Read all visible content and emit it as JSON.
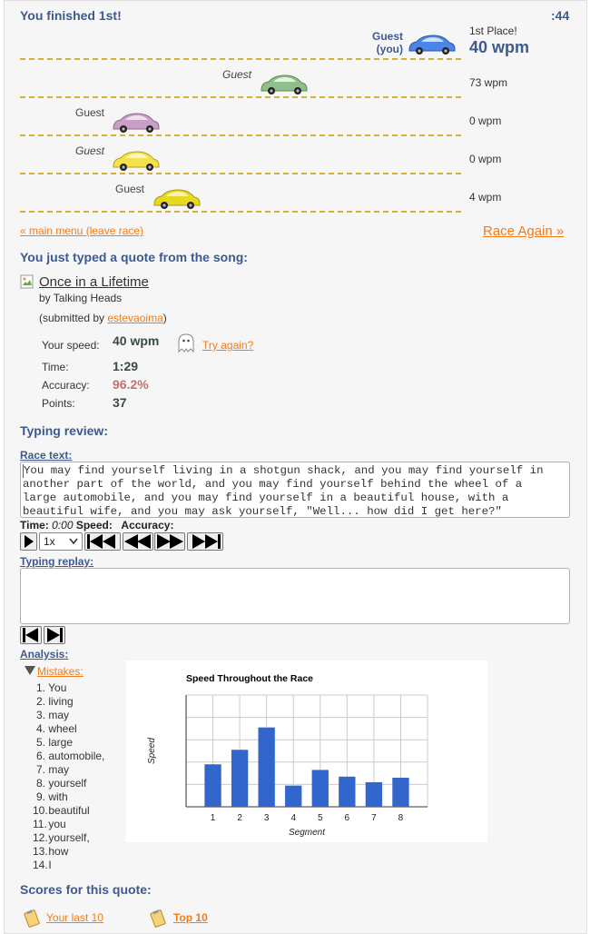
{
  "header": {
    "title": "You finished 1st!",
    "timer": ":44"
  },
  "race": {
    "place_label": "1st Place!",
    "lanes": [
      {
        "name": "Guest",
        "sub": "(you)",
        "wpm": "40 wpm",
        "color": "#4a86e8"
      },
      {
        "name": "Guest",
        "wpm": "73 wpm",
        "color": "#8fbf8a"
      },
      {
        "name": "Guest",
        "wpm": "0 wpm",
        "color": "#c79fc7"
      },
      {
        "name": "Guest",
        "wpm": "0 wpm",
        "color": "#f3e24a"
      },
      {
        "name": "Guest",
        "wpm": "4 wpm",
        "color": "#e8d81f"
      }
    ],
    "main_menu_link": "« main menu (leave race)",
    "race_again_link": "Race Again »"
  },
  "quote": {
    "heading": "You just typed a quote from the song:",
    "song_title": "Once in a Lifetime",
    "artist": "by Talking Heads",
    "submitted_prefix": "(submitted by ",
    "submitter": "estevaoima",
    "submitted_suffix": ")"
  },
  "stats": {
    "speed_label": "Your speed:",
    "speed_value": "40 wpm",
    "try_again": "Try again?",
    "time_label": "Time:",
    "time_value": "1:29",
    "accuracy_label": "Accuracy:",
    "accuracy_value": "96.2%",
    "points_label": "Points:",
    "points_value": "37"
  },
  "review": {
    "heading": "Typing review:",
    "race_text_label": "Race text:",
    "race_text_lines": [
      "You may find yourself living in a shotgun shack, and you may find yourself in",
      "another part of the world, and you may find yourself behind the wheel of a",
      "large automobile, and you may find yourself in a beautiful house, with a",
      "beautiful wife, and you may ask yourself, \"Well... how did I get here?\""
    ],
    "time_label": "Time:",
    "time_value": "0:00",
    "speed_label": "Speed:",
    "accuracy_label": "Accuracy:",
    "playback_speed": "1x",
    "typing_replay_label": "Typing replay:",
    "analysis_label": "Analysis:",
    "mistakes_label": "Mistakes:",
    "mistakes": [
      "You",
      "living",
      "may",
      "wheel",
      "large",
      "automobile,",
      "may",
      "yourself",
      "with",
      "beautiful",
      "you",
      "yourself,",
      "how",
      "I"
    ]
  },
  "chart_data": {
    "type": "bar",
    "title": "Speed Throughout the Race",
    "xlabel": "Segment",
    "ylabel": "Speed",
    "categories": [
      "1",
      "2",
      "3",
      "4",
      "5",
      "6",
      "7",
      "8"
    ],
    "values": [
      38,
      51,
      71,
      19,
      33,
      27,
      22,
      26
    ],
    "ylim": [
      0,
      100
    ],
    "grid": true,
    "bar_color": "#3366cc"
  },
  "scores": {
    "heading": "Scores for this quote:",
    "last10": "Your last 10",
    "top10": "Top 10"
  }
}
